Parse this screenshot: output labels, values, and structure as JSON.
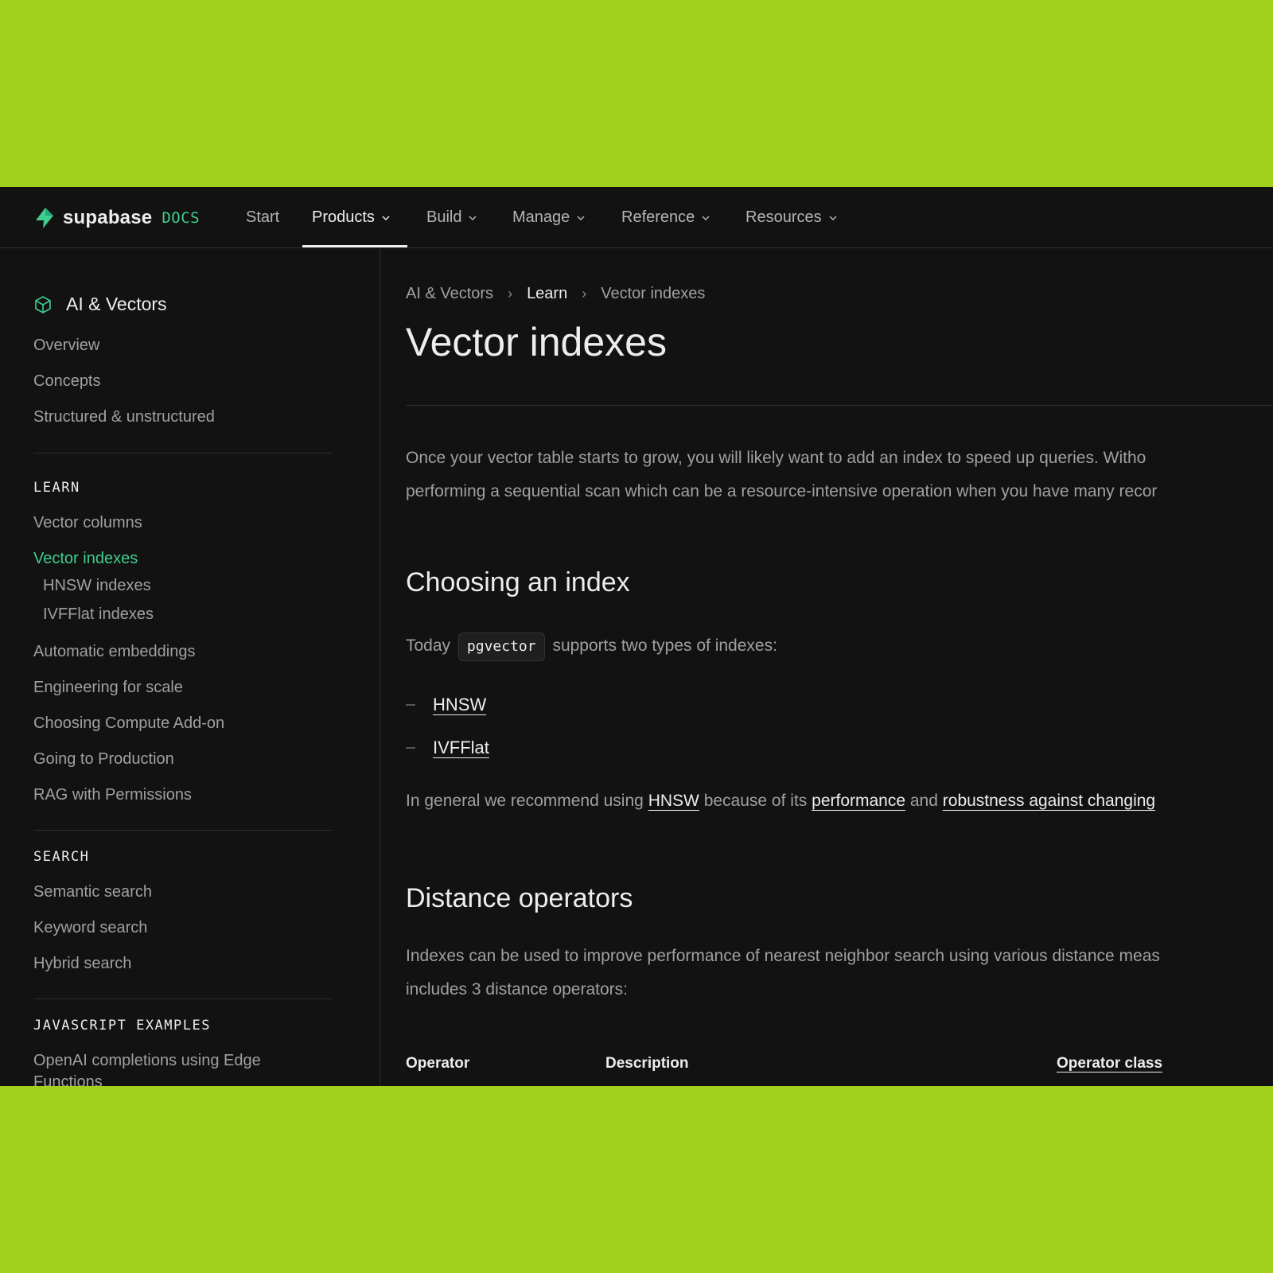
{
  "brand": {
    "name": "supabase",
    "docs_label": "DOCS"
  },
  "nav": {
    "items": [
      {
        "label": "Start",
        "has_dropdown": false
      },
      {
        "label": "Products",
        "has_dropdown": true,
        "active": true
      },
      {
        "label": "Build",
        "has_dropdown": true
      },
      {
        "label": "Manage",
        "has_dropdown": true
      },
      {
        "label": "Reference",
        "has_dropdown": true
      },
      {
        "label": "Resources",
        "has_dropdown": true
      }
    ]
  },
  "sidebar": {
    "title": "AI & Vectors",
    "top_links": [
      "Overview",
      "Concepts",
      "Structured & unstructured"
    ],
    "learn_heading": "LEARN",
    "learn_links": {
      "vector_columns": "Vector columns",
      "vector_indexes": "Vector indexes",
      "hnsw_indexes": "HNSW indexes",
      "ivfflat_indexes": "IVFFlat indexes",
      "automatic_embeddings": "Automatic embeddings",
      "engineering_for_scale": "Engineering for scale",
      "choosing_compute": "Choosing Compute Add-on",
      "going_to_production": "Going to Production",
      "rag_permissions": "RAG with Permissions"
    },
    "search_heading": "SEARCH",
    "search_links": [
      "Semantic search",
      "Keyword search",
      "Hybrid search"
    ],
    "js_heading": "JAVASCRIPT EXAMPLES",
    "js_links": [
      "OpenAI completions using Edge",
      "Functions"
    ]
  },
  "breadcrumb": {
    "items": [
      "AI & Vectors",
      "Learn",
      "Vector indexes"
    ]
  },
  "page": {
    "title": "Vector indexes",
    "intro_line1": "Once your vector table starts to grow, you will likely want to add an index to speed up queries. Witho",
    "intro_line2": "performing a sequential scan which can be a resource-intensive operation when you have many recor",
    "h_choosing": "Choosing an index",
    "today_prefix": "Today",
    "today_code": "pgvector",
    "today_suffix": "supports two types of indexes:",
    "bullets": [
      "HNSW",
      "IVFFlat"
    ],
    "rec_prefix": "In general we recommend using",
    "rec_link1": "HNSW",
    "rec_mid1": "because of its",
    "rec_link2": "performance",
    "rec_mid2": "and",
    "rec_link3": "robustness against changing",
    "h_distance": "Distance operators",
    "dist_line1": "Indexes can be used to improve performance of nearest neighbor search using various distance meas",
    "dist_line2": "includes 3 distance operators:",
    "table_headers": [
      "Operator",
      "Description",
      "Operator class"
    ]
  },
  "colors": {
    "accent": "#3ecf8e",
    "background": "#121212",
    "frame": "#a1d11a"
  }
}
